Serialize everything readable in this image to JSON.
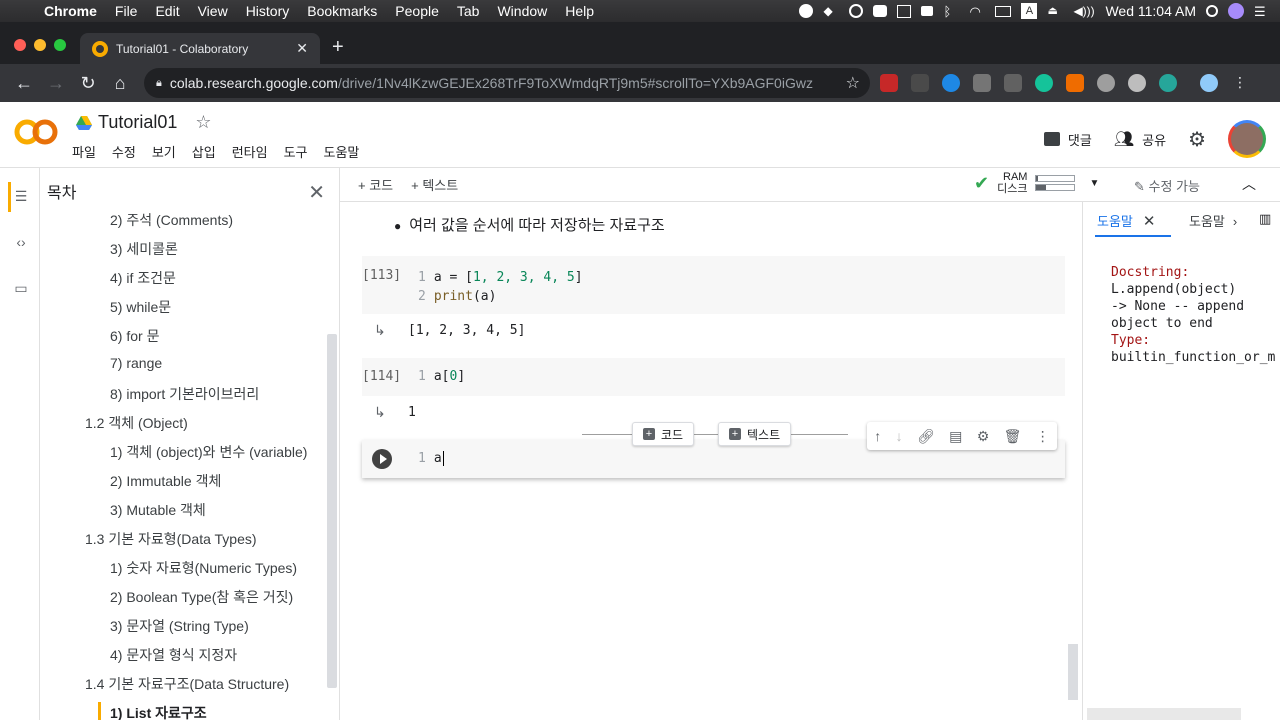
{
  "menubar": {
    "app": "Chrome",
    "items": [
      "File",
      "Edit",
      "View",
      "History",
      "Bookmarks",
      "People",
      "Tab",
      "Window",
      "Help"
    ],
    "clock": "Wed 11:04 AM"
  },
  "browser": {
    "tab_title": "Tutorial01 - Colaboratory",
    "url_host": "colab.research.google.com",
    "url_path": "/drive/1Nv4lKzwGEJEx268TrF9ToXWmdqRTj9m5#scrollTo=YXb9AGF0iGwz"
  },
  "colab": {
    "title": "Tutorial01",
    "menus": [
      "파일",
      "수정",
      "보기",
      "삽입",
      "런타임",
      "도구",
      "도움말"
    ],
    "comments_label": "댓글",
    "share_label": "공유"
  },
  "toolbar": {
    "add_code": "+ 코드",
    "add_text": "+ 텍스트",
    "ram_label": "RAM",
    "disk_label": "디스크",
    "ram_usage": 0.05,
    "disk_usage": 0.25,
    "edit_label": "수정 가능"
  },
  "toc": {
    "title": "목차",
    "items": [
      {
        "label": "2) 주석 (Comments)",
        "level": 2
      },
      {
        "label": "3) 세미콜론",
        "level": 2
      },
      {
        "label": "4) if 조건문",
        "level": 2
      },
      {
        "label": "5) while문",
        "level": 2
      },
      {
        "label": "6) for 문",
        "level": 2
      },
      {
        "label": "7) range",
        "level": 2
      },
      {
        "label": "8) import 기본라이브러리",
        "level": 2
      },
      {
        "label": "1.2 객체 (Object)",
        "level": 1
      },
      {
        "label": "1) 객체 (object)와 변수 (variable)",
        "level": 2
      },
      {
        "label": "2) Immutable 객체",
        "level": 2
      },
      {
        "label": "3) Mutable 객체",
        "level": 2
      },
      {
        "label": "1.3 기본 자료형(Data Types)",
        "level": 1
      },
      {
        "label": "1) 숫자 자료형(Numeric Types)",
        "level": 2
      },
      {
        "label": "2) Boolean Type(참 혹은 거짓)",
        "level": 2
      },
      {
        "label": "3) 문자열 (String Type)",
        "level": 2
      },
      {
        "label": "4) 문자열 형식 지정자",
        "level": 2
      },
      {
        "label": "1.4 기본 자료구조(Data Structure)",
        "level": 1
      },
      {
        "label": "1) List 자료구조",
        "level": 2
      }
    ]
  },
  "notebook": {
    "bullet": "여러 값을 순서에 따라 저장하는 자료구조",
    "cell1": {
      "prompt": "[113]",
      "line1_num": "1",
      "line1_var": "a = [",
      "line1_vals": "1, 2, 3, 4, 5",
      "line1_end": "]",
      "line2_num": "2",
      "line2_fn": "print",
      "line2_rest": "(a)",
      "output": "[1, 2, 3, 4, 5]"
    },
    "cell2": {
      "prompt": "[114]",
      "line1_num": "1",
      "code_a": "a[",
      "code_idx": "0",
      "code_end": "]",
      "output": "1"
    },
    "cell3": {
      "line_num": "1",
      "code": "a"
    },
    "insert_code": "코드",
    "insert_text": "텍스트"
  },
  "help": {
    "tab1": "도움말",
    "tab2": "도움말",
    "docstring_label": "Docstring:",
    "doc_line1": "L.append(object)",
    "doc_line2": "-> None -- append",
    "doc_line3": "object to end",
    "type_label": "Type:",
    "type_value": "builtin_function_or_m"
  }
}
